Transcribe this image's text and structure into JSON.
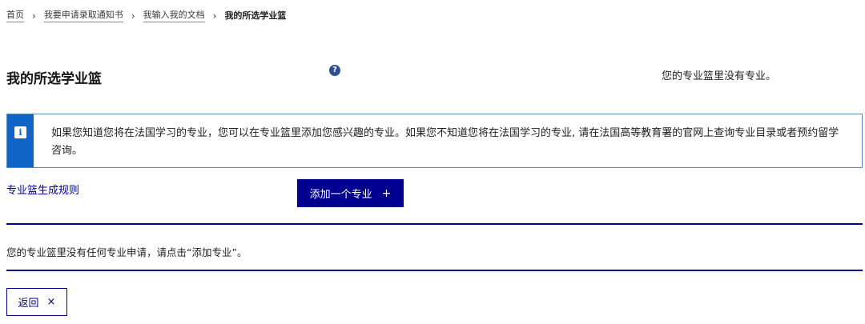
{
  "breadcrumb": {
    "items": [
      "首页",
      "我要申请录取通知书",
      "我输入我的文档"
    ],
    "current": "我的所选学业篮",
    "separator": "›"
  },
  "header": {
    "title": "我的所选学业篮",
    "help_icon": "question-circle-icon",
    "status": "您的专业篮里没有专业。"
  },
  "notice": {
    "icon": "info-icon",
    "text": "如果您知道您将在法国学习的专业，您可以在专业篮里添加您感兴趣的专业。如果您不知道您将在法国学习的专业, 请在法国高等教育署的官网上查询专业目录或者预约留学咨询。"
  },
  "actions": {
    "rules_link": "专业篮生成规则",
    "add_button": "添加一个专业",
    "add_icon": "+"
  },
  "empty": {
    "message": "您的专业篮里没有任何专业申请，请点击“添加专业”。"
  },
  "footer": {
    "back_button": "返回",
    "back_icon": "×"
  },
  "colors": {
    "primary": "#000091",
    "info": "#0f64c8",
    "notice_border": "#5a8ab6"
  }
}
